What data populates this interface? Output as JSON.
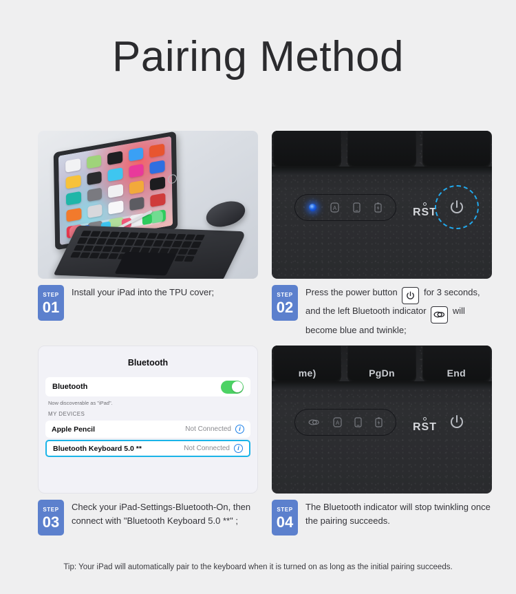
{
  "page": {
    "title": "Pairing Method",
    "background_color": "#efeff0",
    "accent_color": "#5c80cd",
    "highlight_color": "#1ab4e8"
  },
  "steps": [
    {
      "badge_word": "STEP",
      "badge_number": "01",
      "text": "Install your iPad into the TPU cover;",
      "image_alt": "iPad in TPU keyboard cover with trackpad, Apple Pencil and mouse"
    },
    {
      "badge_word": "STEP",
      "badge_number": "02",
      "text_part1": "Press the power button",
      "key1_icon": "power-icon",
      "text_part2": "for 3 seconds, and the left Bluetooth indicator",
      "key2_icon": "bluetooth-link-icon",
      "text_part3": "will become blue and twinkle;",
      "image_alt": "Keyboard indicator strip with blue LED lit and power button circled"
    },
    {
      "badge_word": "STEP",
      "badge_number": "03",
      "text": "Check your iPad-Settings-Bluetooth-On, then connect with \"Bluetooth Keyboard 5.0 **\" ;"
    },
    {
      "badge_word": "STEP",
      "badge_number": "04",
      "text": "The Bluetooth indicator will stop twinkling once the pairing succeeds.",
      "image_alt": "Keyboard indicator strip with Bluetooth LED off, PgDn and End keys above"
    }
  ],
  "bluetooth_panel": {
    "title": "Bluetooth",
    "toggle_label": "Bluetooth",
    "toggle_state": "on",
    "toggle_color": "#4cd264",
    "discoverable_note": "Now discoverable as \"iPad\".",
    "section_header": "MY DEVICES",
    "devices": [
      {
        "name": "Apple Pencil",
        "status": "Not Connected",
        "info_icon": "info-circle-icon",
        "selected": false
      },
      {
        "name": "Bluetooth Keyboard 5.0 **",
        "status": "Not Connected",
        "info_icon": "info-circle-icon",
        "selected": true
      }
    ]
  },
  "keyboard_photo": {
    "rst_label": "RST",
    "indicator_icons": [
      "bluetooth-link-icon",
      "caps-lock-icon",
      "tablet-icon",
      "battery-icon"
    ],
    "power_icon": "power-icon",
    "highlight_ring_color": "#22aaee",
    "led_color": "#1a5fe0",
    "keycaps_top": [
      "me)",
      "PgDn",
      "End"
    ]
  },
  "tip": {
    "prefix": "Tip:",
    "text": "Your iPad will automatically pair to the keyboard when it is turned on as long as the initial pairing succeeds."
  }
}
